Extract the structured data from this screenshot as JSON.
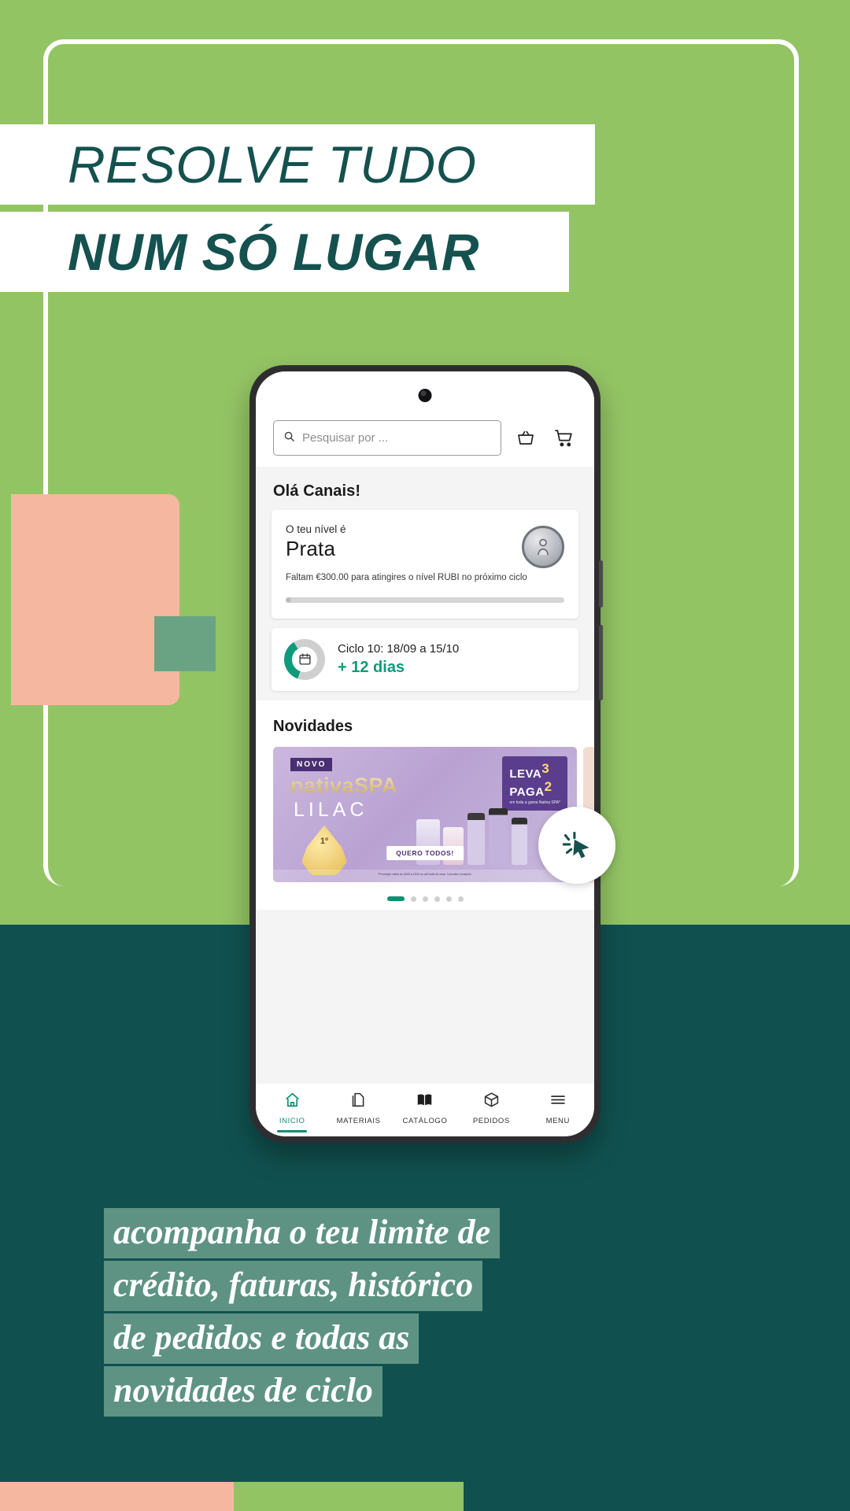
{
  "poster": {
    "headline_line1": "RESOLVE TUDO",
    "headline_line2": "NUM SÓ LUGAR",
    "caption_lines": [
      "acompanha o teu limite de",
      "crédito, faturas, histórico",
      "de pedidos e todas as",
      "novidades de ciclo"
    ],
    "colors": {
      "green": "#93c464",
      "teal": "#10514f",
      "peach": "#f6b7a0",
      "sage": "#6aa383",
      "caption_highlight": "#5e9383",
      "accent_teal": "#0e8f72"
    },
    "cursor_badge_icon": "cursor-click-icon",
    "bottom_strip": [
      "#f6b7a0",
      "#93c464",
      "#10514f"
    ]
  },
  "phone": {
    "top_bar": {
      "search_placeholder": "Pesquisar por ...",
      "search_value": "",
      "search_icon": "search-icon",
      "basket_icon": "basket-icon",
      "cart_icon": "shopping-cart-icon"
    },
    "greeting": "Olá Canais!",
    "level_card": {
      "label": "O teu nível é",
      "level": "Prata",
      "note": "Faltam €300.00 para atingires o nível RUBI no próximo ciclo",
      "progress_percent": 2,
      "medal_icon": "medal-icon"
    },
    "cycle_card": {
      "calendar_icon": "calendar-icon",
      "cycle_text": "Ciclo 10: 18/09 a 15/10",
      "days_left": "+ 12 dias",
      "donut_percent": 36
    },
    "news": {
      "title": "Novidades",
      "banner": {
        "tag": "NOVO",
        "brand": "nativaSPA",
        "product": "LILAC",
        "offer_line1": "LEVA",
        "offer_num1": "3",
        "offer_line2": "PAGA",
        "offer_num2": "2",
        "offer_small": "em toda a gama Nativa SPA*",
        "badge_text": "1º",
        "cta": "QUERO TODOS!",
        "legal": "*Promoção válida de 18/09 a 15/10 ou até limite de stock. Consultar condições."
      },
      "dots_total": 6,
      "dots_active_index": 0
    },
    "nav": [
      {
        "label": "INICIO",
        "icon": "home-icon",
        "active": true
      },
      {
        "label": "MATERIAIS",
        "icon": "documents-icon",
        "active": false
      },
      {
        "label": "CATÁLOGO",
        "icon": "book-icon",
        "active": false
      },
      {
        "label": "PEDIDOS",
        "icon": "box-icon",
        "active": false
      },
      {
        "label": "MENU",
        "icon": "hamburger-menu-icon",
        "active": false
      }
    ]
  }
}
